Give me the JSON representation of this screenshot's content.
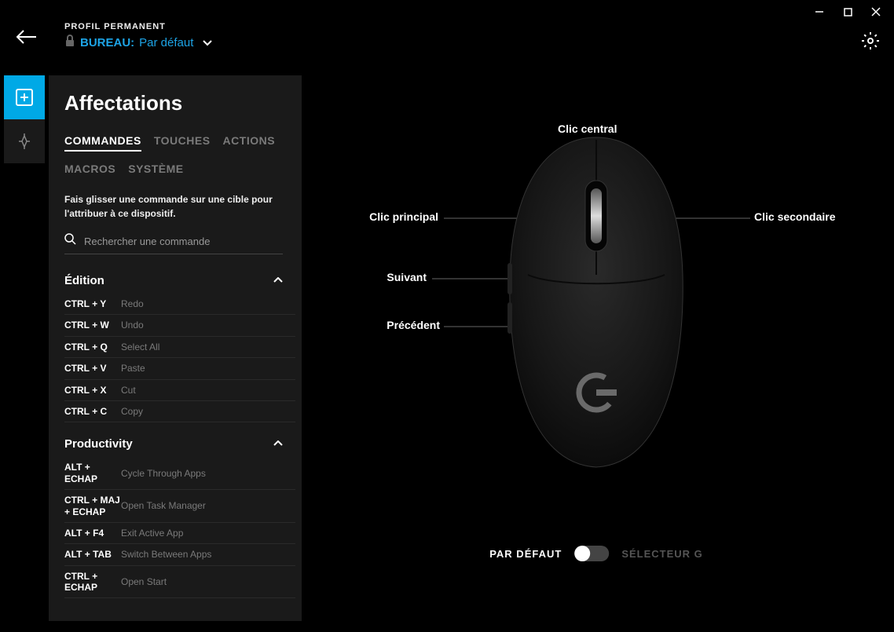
{
  "titlebar": {
    "minimize": "—",
    "maximize": "□",
    "close": "✕"
  },
  "header": {
    "profile_label": "PROFIL PERMANENT",
    "bureau": "BUREAU:",
    "profile_name": "Par défaut"
  },
  "panel": {
    "title": "Affectations",
    "tabs": [
      "COMMANDES",
      "TOUCHES",
      "ACTIONS",
      "MACROS",
      "SYSTÈME"
    ],
    "active_tab": 0,
    "instruction": "Fais glisser une commande sur une cible pour l'attribuer à ce dispositif.",
    "search_placeholder": "Rechercher une commande",
    "categories": [
      {
        "name": "Édition",
        "commands": [
          {
            "key": "CTRL + Y",
            "label": "Redo"
          },
          {
            "key": "CTRL + W",
            "label": "Undo"
          },
          {
            "key": "CTRL + Q",
            "label": "Select All"
          },
          {
            "key": "CTRL + V",
            "label": "Paste"
          },
          {
            "key": "CTRL + X",
            "label": "Cut"
          },
          {
            "key": "CTRL + C",
            "label": "Copy"
          }
        ]
      },
      {
        "name": "Productivity",
        "commands": [
          {
            "key": "ALT + ECHAP",
            "label": "Cycle Through Apps"
          },
          {
            "key": "CTRL + MAJ + ECHAP",
            "label": "Open Task Manager"
          },
          {
            "key": "ALT + F4",
            "label": "Exit Active App"
          },
          {
            "key": "ALT + TAB",
            "label": "Switch Between Apps"
          },
          {
            "key": "CTRL + ECHAP",
            "label": "Open Start"
          }
        ]
      }
    ]
  },
  "viz": {
    "callouts": {
      "top": "Clic central",
      "primary": "Clic principal",
      "secondary": "Clic secondaire",
      "forward": "Suivant",
      "back": "Précédent"
    }
  },
  "toggle": {
    "left": "PAR DÉFAUT",
    "right": "SÉLECTEUR G"
  }
}
